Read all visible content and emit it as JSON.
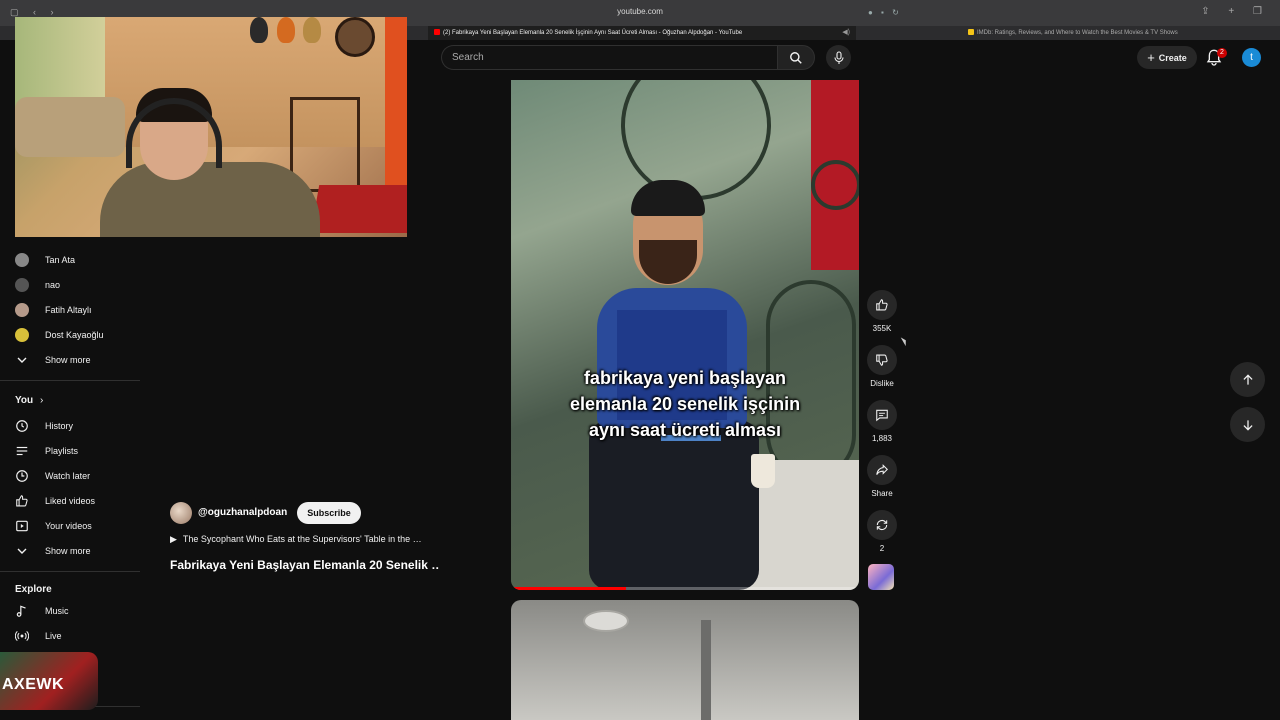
{
  "browser": {
    "url": "youtube.com",
    "active_tab": "(2) Fabrikaya Yeni Başlayan Elemanla 20 Senelik İşçinin Aynı Saat Ücreti Alması - Oğuzhan Alpdoğan - YouTube",
    "other_tab": "IMDb: Ratings, Reviews, and Where to Watch the Best Movies & TV Shows",
    "active_tab_favicon_color": "#ff0000",
    "other_tab_favicon_color": "#f5c518"
  },
  "header": {
    "search_placeholder": "Search",
    "create_label": "Create",
    "notification_count": "2",
    "user_initial": "t"
  },
  "subscriptions": [
    {
      "name": "Tan Ata",
      "avatar_color": "#888888"
    },
    {
      "name": "nao",
      "avatar_color": "#555555"
    },
    {
      "name": "Fatih Altaylı",
      "avatar_color": "#b59a8a"
    },
    {
      "name": "Dost Kayaoğlu",
      "avatar_color": "#d8c03a"
    }
  ],
  "subscriptions_show_more": "Show more",
  "you_section": {
    "heading": "You",
    "items": [
      {
        "label": "History",
        "icon": "history-icon"
      },
      {
        "label": "Playlists",
        "icon": "playlists-icon"
      },
      {
        "label": "Watch later",
        "icon": "watch-later-icon"
      },
      {
        "label": "Liked videos",
        "icon": "like-icon"
      },
      {
        "label": "Your videos",
        "icon": "your-videos-icon"
      }
    ],
    "show_more": "Show more"
  },
  "explore_section": {
    "heading": "Explore",
    "items": [
      {
        "label": "Music",
        "icon": "music-icon"
      },
      {
        "label": "Live",
        "icon": "live-icon"
      }
    ]
  },
  "corner_thumbnail_text": "AXEWK",
  "short": {
    "caption_lines": [
      "fabrikaya yeni başlayan",
      "elemanla 20 senelik işçinin",
      "aynı saat ücreti alması"
    ],
    "channel": "@oguzhanalpdoan",
    "subscribe_label": "Subscribe",
    "playlist_text": "The Sycophant Who Eats at the Supervisors' Table in the …",
    "title": "Fabrikaya Yeni Başlayan Elemanla 20 Senelik …",
    "progress_percent": 33,
    "likes": "355K",
    "dislike_label": "Dislike",
    "comments": "1,883",
    "share_label": "Share",
    "remix_count": "2"
  },
  "colors": {
    "accent": "#ff0000",
    "background": "#0f0f0f",
    "button_bg": "#272727"
  }
}
